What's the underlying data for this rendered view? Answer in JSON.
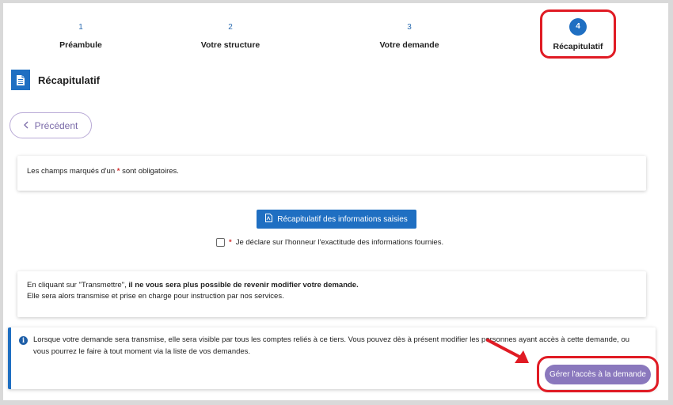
{
  "stepper": {
    "steps": [
      {
        "number": "1",
        "label": "Préambule"
      },
      {
        "number": "2",
        "label": "Votre structure"
      },
      {
        "number": "3",
        "label": "Votre demande"
      },
      {
        "number": "4",
        "label": "Récapitulatif"
      }
    ],
    "active_index": 3
  },
  "header": {
    "title": "Récapitulatif",
    "icon": "document-icon"
  },
  "navigation": {
    "previous_label": "Précédent"
  },
  "required_notice": {
    "text_before": "Les champs marqués d'un ",
    "star": "*",
    "text_after": " sont obligatoires."
  },
  "summary_button": {
    "label": "Récapitulatif des informations saisies",
    "icon": "pdf-icon"
  },
  "declaration": {
    "star": "*",
    "label": " Je déclare sur l'honneur l'exactitude des informations fournies.",
    "checked": false
  },
  "warning": {
    "text_normal": "En cliquant sur \"Transmettre\", ",
    "text_bold": "il ne vous sera plus possible de revenir modifier votre demande.",
    "line2": "Elle sera alors transmise et prise en charge pour instruction par nos services."
  },
  "info": {
    "text": "Lorsque votre demande sera transmise, elle sera visible par tous les comptes reliés à ce tiers. Vous pouvez dès à présent modifier les personnes ayant accès à cette demande, ou vous pourrez le faire à tout moment via la liste de vos demandes.",
    "icon": "info-icon"
  },
  "access_button": {
    "label": "Gérer l'accès à la demande"
  },
  "colors": {
    "primary": "#1f6fc2",
    "access_button": "#8a78bd",
    "highlight": "#e01b24",
    "required_star": "#d32f2f"
  }
}
